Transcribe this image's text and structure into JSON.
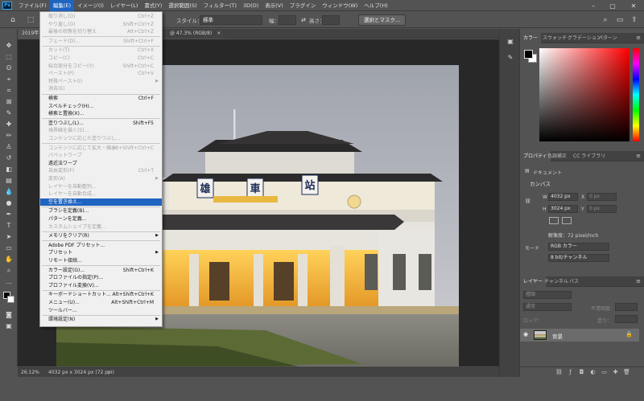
{
  "menubar": {
    "logo": "Ps",
    "items": [
      "ファイル(F)",
      "編集(E)",
      "イメージ(I)",
      "レイヤー(L)",
      "書式(Y)",
      "選択範囲(S)",
      "フィルター(T)",
      "3D(D)",
      "表示(V)",
      "プラグイン",
      "ウィンドウ(W)",
      "ヘルプ(H)"
    ],
    "active_index": 1,
    "window_controls": [
      "minimize",
      "maximize",
      "close"
    ]
  },
  "options_bar": {
    "style_label": "スタイル：",
    "style_value": "標準",
    "width_label": "幅：",
    "height_label": "高さ：",
    "select_mask_button": "選択とマスク..."
  },
  "document": {
    "tab_title_left": "2019年",
    "tab_title_right": "@ 47.3% (RGB/8)",
    "tab_close": "×"
  },
  "status_bar": {
    "zoom": "26.12%",
    "info": "4032 px x 3024 px (72 ppi)",
    "arrow": "›"
  },
  "edit_menu": {
    "items": [
      {
        "label": "取り消し(O)",
        "shortcut": "Ctrl+Z",
        "enabled": false
      },
      {
        "label": "やり直し(O)",
        "shortcut": "Shift+Ctrl+Z",
        "enabled": false
      },
      {
        "label": "最後の状態を切り替え",
        "shortcut": "Alt+Ctrl+Z",
        "enabled": false
      },
      {
        "sep": true
      },
      {
        "label": "フェード(D)...",
        "shortcut": "Shift+Ctrl+F",
        "enabled": false
      },
      {
        "sep": true
      },
      {
        "label": "カット(T)",
        "shortcut": "Ctrl+X",
        "enabled": false
      },
      {
        "label": "コピー(C)",
        "shortcut": "Ctrl+C",
        "enabled": false
      },
      {
        "label": "結合部分をコピー(Y)",
        "shortcut": "Shift+Ctrl+C",
        "enabled": false
      },
      {
        "label": "ペースト(P)",
        "shortcut": "Ctrl+V",
        "enabled": false
      },
      {
        "label": "特殊ペースト(I)",
        "submenu": true,
        "enabled": false
      },
      {
        "label": "消去(E)",
        "enabled": false
      },
      {
        "sep": true
      },
      {
        "label": "検索",
        "shortcut": "Ctrl+F",
        "enabled": true
      },
      {
        "label": "スペルチェック(H)...",
        "enabled": true
      },
      {
        "label": "検索と置換(X)...",
        "enabled": true
      },
      {
        "sep": true
      },
      {
        "label": "塗りつぶし(L)...",
        "shortcut": "Shift+F5",
        "enabled": true
      },
      {
        "label": "境界線を描く(S)...",
        "enabled": false
      },
      {
        "label": "コンテンツに応じた塗りつぶし...",
        "enabled": false
      },
      {
        "sep": true
      },
      {
        "label": "コンテンツに応じて拡大・縮小",
        "shortcut": "Alt+Shift+Ctrl+C",
        "enabled": false
      },
      {
        "label": "パペットワープ",
        "enabled": false
      },
      {
        "label": "遠近法ワープ",
        "enabled": true
      },
      {
        "label": "自由変形(F)",
        "shortcut": "Ctrl+T",
        "enabled": false
      },
      {
        "label": "変形(A)",
        "submenu": true,
        "enabled": false
      },
      {
        "label": "レイヤーを自動整列...",
        "enabled": false
      },
      {
        "label": "レイヤーを自動合成...",
        "enabled": false
      },
      {
        "label": "空を置き換え...",
        "enabled": true,
        "highlighted": true
      },
      {
        "sep": true
      },
      {
        "label": "ブラシを定義(B)...",
        "enabled": true
      },
      {
        "label": "パターンを定義...",
        "enabled": true
      },
      {
        "label": "カスタムシェイプを定義...",
        "enabled": false
      },
      {
        "sep": true
      },
      {
        "label": "メモリをクリア(R)",
        "submenu": true,
        "enabled": true
      },
      {
        "sep": true
      },
      {
        "label": "Adobe PDF プリセット...",
        "enabled": true
      },
      {
        "label": "プリセット",
        "submenu": true,
        "enabled": true
      },
      {
        "label": "リモート接続...",
        "enabled": true
      },
      {
        "sep": true
      },
      {
        "label": "カラー設定(G)...",
        "shortcut": "Shift+Ctrl+K",
        "enabled": true
      },
      {
        "label": "プロファイルの指定(P)...",
        "enabled": true
      },
      {
        "label": "プロファイル変換(V)...",
        "enabled": true
      },
      {
        "sep": true
      },
      {
        "label": "キーボードショートカット...",
        "shortcut": "Alt+Shift+Ctrl+K",
        "enabled": true
      },
      {
        "label": "メニュー(U)...",
        "shortcut": "Alt+Shift+Ctrl+M",
        "enabled": true
      },
      {
        "label": "ツールバー...",
        "enabled": true
      },
      {
        "sep": true
      },
      {
        "label": "環境設定(N)",
        "submenu": true,
        "enabled": true
      }
    ]
  },
  "color_panel": {
    "tabs": [
      "カラー",
      "スウォッチ",
      "グラデーション",
      "パターン"
    ],
    "active_tab": 0,
    "hue_color": "#ff0000"
  },
  "properties_panel": {
    "tabs": [
      "プロパティ",
      "色調補正",
      "CC ライブラリ"
    ],
    "active_tab": 0,
    "doc_label": "ドキュメント",
    "canvas_header": "カンバス",
    "w_label": "W",
    "w_value": "4032 px",
    "x_label": "X",
    "x_value": "0 px",
    "h_label": "H",
    "h_value": "3024 px",
    "y_label": "Y",
    "y_value": "0 px",
    "resolution": "解像度：72 pixel/inch",
    "mode_label": "モード",
    "mode_value": "RGB カラー",
    "bits_value": "8 bit/チャンネル"
  },
  "layers_panel": {
    "tabs": [
      "レイヤー",
      "チャンネル",
      "パス"
    ],
    "active_tab": 0,
    "search_placeholder": "種類",
    "blend_mode": "通常",
    "opacity_label": "不透明度：",
    "lock_label": "ロック：",
    "fill_label": "塗り：",
    "layer_name": "背景"
  },
  "photo": {
    "sign_chars": [
      "雄",
      "車",
      "站"
    ]
  },
  "colors": {
    "app_bg": "#535353",
    "canvas_bg": "#282828",
    "panel_dark": "#424242",
    "menu_bg": "#f0f0f0",
    "highlight": "#1f64c0",
    "ps_blue": "#31a8ff"
  }
}
